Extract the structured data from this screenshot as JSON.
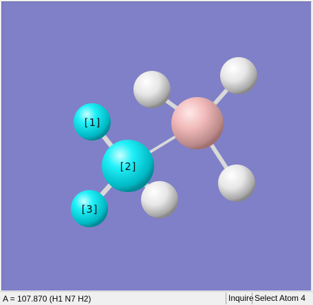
{
  "viewer": {
    "background_color": "#8080c8",
    "atoms": [
      {
        "id": "atom-1",
        "element": "H",
        "label": "[1]",
        "color": "#00e0e8"
      },
      {
        "id": "atom-2",
        "element": "N",
        "label": "[2]",
        "color": "#00e0e8"
      },
      {
        "id": "atom-3",
        "element": "H",
        "label": "[3]",
        "color": "#00e0e8"
      },
      {
        "id": "atom-4",
        "element": "H",
        "label": "",
        "color": "#ffffff"
      },
      {
        "id": "atom-5",
        "element": "B",
        "label": "",
        "color": "#f0b8b8"
      },
      {
        "id": "atom-6",
        "element": "H",
        "label": "",
        "color": "#ffffff"
      },
      {
        "id": "atom-7",
        "element": "H",
        "label": "",
        "color": "#ffffff"
      },
      {
        "id": "atom-8",
        "element": "H",
        "label": "",
        "color": "#ffffff"
      }
    ],
    "bond_color": "#d8d8d8"
  },
  "statusbar": {
    "measurement": "A = 107.870 (H1 N7 H2)",
    "mode": "Inquire",
    "action": "Select Atom 4"
  }
}
